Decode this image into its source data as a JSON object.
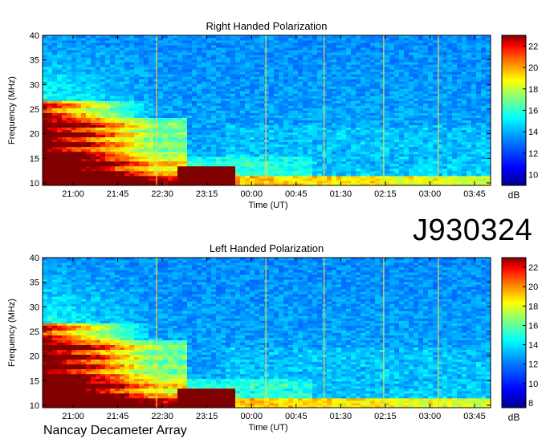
{
  "figure": {
    "observation_id": "J930324",
    "instrument": "Nancay Decameter Array"
  },
  "chart_data": [
    {
      "type": "heatmap",
      "title": "Right Handed Polarization",
      "xlabel": "Time (UT)",
      "ylabel": "Frequency (MHz)",
      "x_ticks": [
        "21:00",
        "21:45",
        "22:30",
        "23:15",
        "00:00",
        "00:45",
        "01:30",
        "02:15",
        "03:00",
        "03:45"
      ],
      "y_ticks": [
        10,
        15,
        20,
        25,
        30,
        35,
        40
      ],
      "ylim": [
        9.5,
        40
      ],
      "colorbar": {
        "label": "dB",
        "ticks": [
          10,
          12,
          14,
          16,
          18,
          20,
          22
        ],
        "range": [
          9,
          23
        ]
      },
      "colormap": [
        "#00008f",
        "#0000ff",
        "#0080ff",
        "#00ffff",
        "#80ff80",
        "#ffff00",
        "#ff8000",
        "#ff0000",
        "#800000"
      ]
    },
    {
      "type": "heatmap",
      "title": "Left Handed Polarization",
      "xlabel": "Time (UT)",
      "ylabel": "Frequency (MHz)",
      "x_ticks": [
        "21:00",
        "21:45",
        "22:30",
        "23:15",
        "00:00",
        "00:45",
        "01:30",
        "02:15",
        "03:00",
        "03:45"
      ],
      "y_ticks": [
        10,
        15,
        20,
        25,
        30,
        35,
        40
      ],
      "ylim": [
        9.5,
        40
      ],
      "colorbar": {
        "label": "dB",
        "ticks": [
          8,
          10,
          12,
          14,
          16,
          18,
          20,
          22
        ],
        "range": [
          7.5,
          23
        ]
      },
      "colormap": [
        "#00008f",
        "#0000ff",
        "#0080ff",
        "#00ffff",
        "#80ff80",
        "#ffff00",
        "#ff8000",
        "#ff0000",
        "#800000"
      ]
    }
  ]
}
